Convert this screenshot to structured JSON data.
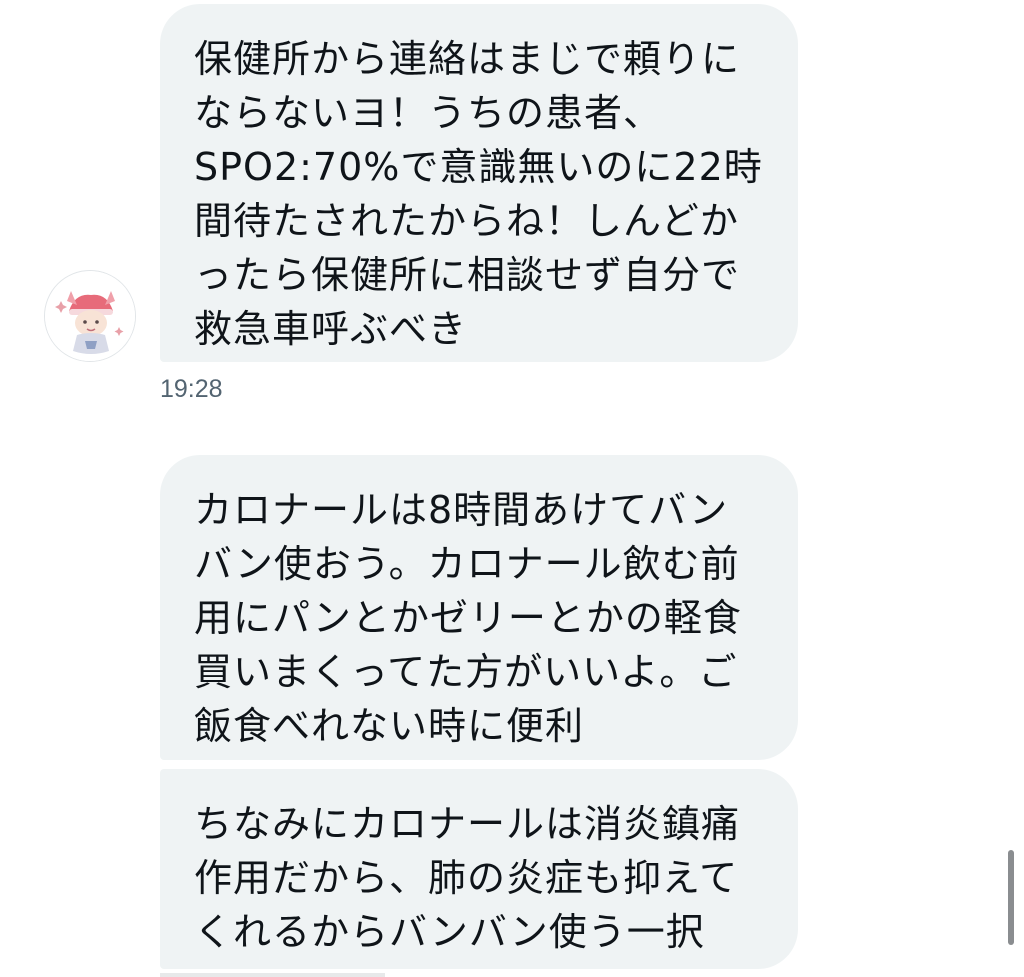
{
  "conversation": {
    "messages": [
      {
        "lines": [
          "保健所から連絡はまじで頼りに",
          "ならないヨ！うちの患者、",
          "SPO2:70%で意識無いのに22時",
          "間待たされたからね！しんどか",
          "ったら保健所に相談せず自分で",
          "救急車呼ぶべき"
        ]
      },
      {
        "lines": [
          "カロナールは8時間あけてバン",
          "バン使おう。カロナール飲む前",
          "用にパンとかゼリーとかの軽食",
          "買いまくってた方がいいよ。ご",
          "飯食べれない時に便利"
        ]
      },
      {
        "lines": [
          "ちなみにカロナールは消炎鎮痛",
          "作用だから、肺の炎症も抑えて",
          "くれるからバンバン使う一択"
        ]
      }
    ],
    "timestamp": "19:28",
    "bubble_color": "#eff3f4",
    "text_color": "#0f1419",
    "timestamp_color": "#536471"
  }
}
